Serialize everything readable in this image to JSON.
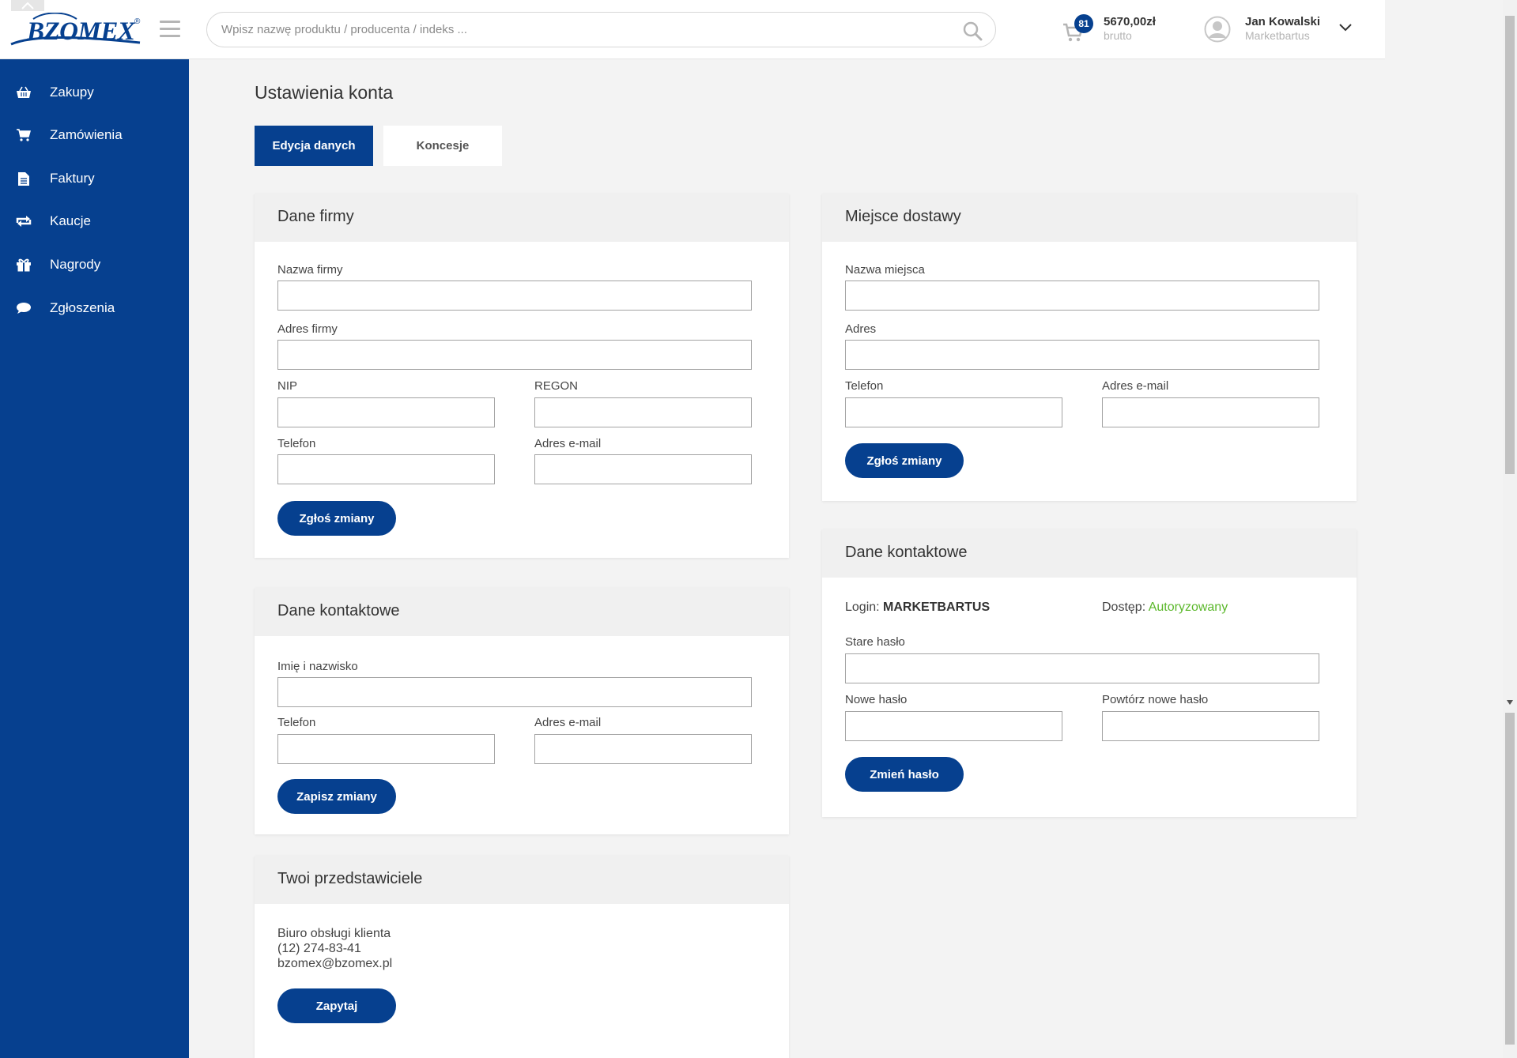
{
  "header": {
    "logo_text": "BZOMEX",
    "logo_reg": "®",
    "search_placeholder": "Wpisz nazwę produktu / producenta / indeks ...",
    "cart_count": "81",
    "cart_amount": "5670,00zł",
    "cart_sub": "brutto",
    "user_name": "Jan Kowalski",
    "user_sub": "Marketbartus"
  },
  "sidebar": {
    "items": [
      {
        "label": "Zakupy",
        "icon": "basket-icon"
      },
      {
        "label": "Zamówienia",
        "icon": "cart-icon"
      },
      {
        "label": "Faktury",
        "icon": "document-icon"
      },
      {
        "label": "Kaucje",
        "icon": "exchange-icon"
      },
      {
        "label": "Nagrody",
        "icon": "gift-icon"
      },
      {
        "label": "Zgłoszenia",
        "icon": "chat-icon"
      }
    ]
  },
  "main": {
    "title": "Ustawienia konta",
    "tabs": [
      {
        "label": "Edycja danych",
        "active": true
      },
      {
        "label": "Koncesje",
        "active": false
      }
    ]
  },
  "company": {
    "title": "Dane firmy",
    "name_label": "Nazwa firmy",
    "address_label": "Adres firmy",
    "nip_label": "NIP",
    "regon_label": "REGON",
    "phone_label": "Telefon",
    "email_label": "Adres e-mail",
    "submit_label": "Zgłoś zmiany"
  },
  "contact": {
    "title": "Dane kontaktowe",
    "name_label": "Imię i nazwisko",
    "phone_label": "Telefon",
    "email_label": "Adres e-mail",
    "submit_label": "Zapisz zmiany"
  },
  "reps": {
    "title": "Twoi przedstawiciele",
    "line1": "Biuro obsługi klienta",
    "line2": "(12) 274-83-41",
    "line3": "bzomex@bzomex.pl",
    "submit_label": "Zapytaj"
  },
  "delivery": {
    "title": "Miejsce dostawy",
    "name_label": "Nazwa miejsca",
    "address_label": "Adres",
    "phone_label": "Telefon",
    "email_label": "Adres e-mail",
    "submit_label": "Zgłoś zmiany"
  },
  "account": {
    "title": "Dane kontaktowe",
    "login_label": "Login:",
    "login_value": "MARKETBARTUS",
    "access_label": "Dostęp:",
    "access_value": "Autoryzowany",
    "old_pw_label": "Stare hasło",
    "new_pw_label": "Nowe hasło",
    "repeat_pw_label": "Powtórz nowe hasło",
    "submit_label": "Zmień hasło"
  },
  "colors": {
    "brand": "#06408f",
    "access_ok": "#5cb82c"
  }
}
